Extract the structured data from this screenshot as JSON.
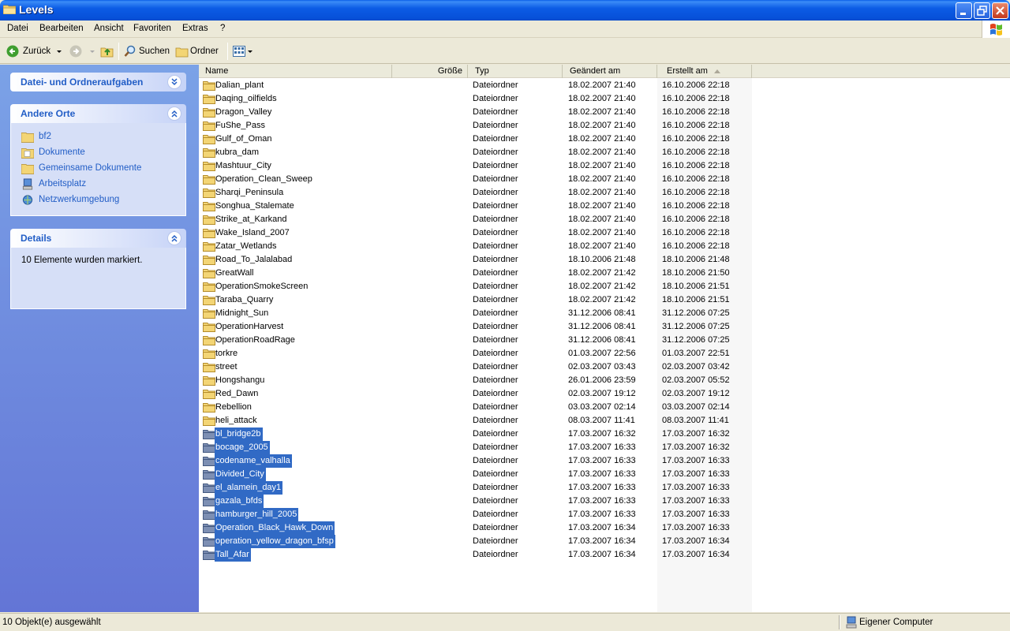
{
  "window": {
    "title": "Levels"
  },
  "menu": [
    "Datei",
    "Bearbeiten",
    "Ansicht",
    "Favoriten",
    "Extras",
    "?"
  ],
  "toolbar": {
    "back_label": "Zurück",
    "search_label": "Suchen",
    "folders_label": "Ordner"
  },
  "left_pane": {
    "tasks_title": "Datei- und Ordneraufgaben",
    "places_title": "Andere Orte",
    "places": [
      {
        "label": "bf2",
        "icon": "folder-icon"
      },
      {
        "label": "Dokumente",
        "icon": "documents-folder-icon"
      },
      {
        "label": "Gemeinsame Dokumente",
        "icon": "shared-folder-icon"
      },
      {
        "label": "Arbeitsplatz",
        "icon": "my-computer-icon"
      },
      {
        "label": "Netzwerkumgebung",
        "icon": "network-icon"
      }
    ],
    "details_title": "Details",
    "details_text": "10 Elemente wurden markiert."
  },
  "columns": {
    "name": "Name",
    "size": "Größe",
    "type": "Typ",
    "modified": "Geändert am",
    "created": "Erstellt am"
  },
  "sort_column": "created",
  "files": [
    {
      "name": "Dalian_plant",
      "type": "Dateiordner",
      "modified": "18.02.2007 21:40",
      "created": "16.10.2006 22:18",
      "selected": false
    },
    {
      "name": "Daqing_oilfields",
      "type": "Dateiordner",
      "modified": "18.02.2007 21:40",
      "created": "16.10.2006 22:18",
      "selected": false
    },
    {
      "name": "Dragon_Valley",
      "type": "Dateiordner",
      "modified": "18.02.2007 21:40",
      "created": "16.10.2006 22:18",
      "selected": false
    },
    {
      "name": "FuShe_Pass",
      "type": "Dateiordner",
      "modified": "18.02.2007 21:40",
      "created": "16.10.2006 22:18",
      "selected": false
    },
    {
      "name": "Gulf_of_Oman",
      "type": "Dateiordner",
      "modified": "18.02.2007 21:40",
      "created": "16.10.2006 22:18",
      "selected": false
    },
    {
      "name": "kubra_dam",
      "type": "Dateiordner",
      "modified": "18.02.2007 21:40",
      "created": "16.10.2006 22:18",
      "selected": false
    },
    {
      "name": "Mashtuur_City",
      "type": "Dateiordner",
      "modified": "18.02.2007 21:40",
      "created": "16.10.2006 22:18",
      "selected": false
    },
    {
      "name": "Operation_Clean_Sweep",
      "type": "Dateiordner",
      "modified": "18.02.2007 21:40",
      "created": "16.10.2006 22:18",
      "selected": false
    },
    {
      "name": "Sharqi_Peninsula",
      "type": "Dateiordner",
      "modified": "18.02.2007 21:40",
      "created": "16.10.2006 22:18",
      "selected": false
    },
    {
      "name": "Songhua_Stalemate",
      "type": "Dateiordner",
      "modified": "18.02.2007 21:40",
      "created": "16.10.2006 22:18",
      "selected": false
    },
    {
      "name": "Strike_at_Karkand",
      "type": "Dateiordner",
      "modified": "18.02.2007 21:40",
      "created": "16.10.2006 22:18",
      "selected": false
    },
    {
      "name": "Wake_Island_2007",
      "type": "Dateiordner",
      "modified": "18.02.2007 21:40",
      "created": "16.10.2006 22:18",
      "selected": false
    },
    {
      "name": "Zatar_Wetlands",
      "type": "Dateiordner",
      "modified": "18.02.2007 21:40",
      "created": "16.10.2006 22:18",
      "selected": false
    },
    {
      "name": "Road_To_Jalalabad",
      "type": "Dateiordner",
      "modified": "18.10.2006 21:48",
      "created": "18.10.2006 21:48",
      "selected": false
    },
    {
      "name": "GreatWall",
      "type": "Dateiordner",
      "modified": "18.02.2007 21:42",
      "created": "18.10.2006 21:50",
      "selected": false
    },
    {
      "name": "OperationSmokeScreen",
      "type": "Dateiordner",
      "modified": "18.02.2007 21:42",
      "created": "18.10.2006 21:51",
      "selected": false
    },
    {
      "name": "Taraba_Quarry",
      "type": "Dateiordner",
      "modified": "18.02.2007 21:42",
      "created": "18.10.2006 21:51",
      "selected": false
    },
    {
      "name": "Midnight_Sun",
      "type": "Dateiordner",
      "modified": "31.12.2006 08:41",
      "created": "31.12.2006 07:25",
      "selected": false
    },
    {
      "name": "OperationHarvest",
      "type": "Dateiordner",
      "modified": "31.12.2006 08:41",
      "created": "31.12.2006 07:25",
      "selected": false
    },
    {
      "name": "OperationRoadRage",
      "type": "Dateiordner",
      "modified": "31.12.2006 08:41",
      "created": "31.12.2006 07:25",
      "selected": false
    },
    {
      "name": "torkre",
      "type": "Dateiordner",
      "modified": "01.03.2007 22:56",
      "created": "01.03.2007 22:51",
      "selected": false
    },
    {
      "name": "street",
      "type": "Dateiordner",
      "modified": "02.03.2007 03:43",
      "created": "02.03.2007 03:42",
      "selected": false
    },
    {
      "name": "Hongshangu",
      "type": "Dateiordner",
      "modified": "26.01.2006 23:59",
      "created": "02.03.2007 05:52",
      "selected": false
    },
    {
      "name": "Red_Dawn",
      "type": "Dateiordner",
      "modified": "02.03.2007 19:12",
      "created": "02.03.2007 19:12",
      "selected": false
    },
    {
      "name": "Rebellion",
      "type": "Dateiordner",
      "modified": "03.03.2007 02:14",
      "created": "03.03.2007 02:14",
      "selected": false
    },
    {
      "name": "heli_attack",
      "type": "Dateiordner",
      "modified": "08.03.2007 11:41",
      "created": "08.03.2007 11:41",
      "selected": false
    },
    {
      "name": "bl_bridge2b",
      "type": "Dateiordner",
      "modified": "17.03.2007 16:32",
      "created": "17.03.2007 16:32",
      "selected": true
    },
    {
      "name": "bocage_2005",
      "type": "Dateiordner",
      "modified": "17.03.2007 16:33",
      "created": "17.03.2007 16:32",
      "selected": true
    },
    {
      "name": "codename_valhalla",
      "type": "Dateiordner",
      "modified": "17.03.2007 16:33",
      "created": "17.03.2007 16:33",
      "selected": true
    },
    {
      "name": "Divided_City",
      "type": "Dateiordner",
      "modified": "17.03.2007 16:33",
      "created": "17.03.2007 16:33",
      "selected": true
    },
    {
      "name": "el_alamein_day1",
      "type": "Dateiordner",
      "modified": "17.03.2007 16:33",
      "created": "17.03.2007 16:33",
      "selected": true
    },
    {
      "name": "gazala_bfds",
      "type": "Dateiordner",
      "modified": "17.03.2007 16:33",
      "created": "17.03.2007 16:33",
      "selected": true
    },
    {
      "name": "hamburger_hill_2005",
      "type": "Dateiordner",
      "modified": "17.03.2007 16:33",
      "created": "17.03.2007 16:33",
      "selected": true
    },
    {
      "name": "Operation_Black_Hawk_Down",
      "type": "Dateiordner",
      "modified": "17.03.2007 16:34",
      "created": "17.03.2007 16:33",
      "selected": true
    },
    {
      "name": "operation_yellow_dragon_bfsp",
      "type": "Dateiordner",
      "modified": "17.03.2007 16:34",
      "created": "17.03.2007 16:34",
      "selected": true
    },
    {
      "name": "Tall_Afar",
      "type": "Dateiordner",
      "modified": "17.03.2007 16:34",
      "created": "17.03.2007 16:34",
      "selected": true
    }
  ],
  "status": {
    "left": "10 Objekt(e) ausgewählt",
    "right": "Eigener Computer"
  },
  "colors": {
    "selection": "#316ac5",
    "titlebar": "#0a5ee8",
    "link": "#215dc6",
    "folder": "#f3d575"
  }
}
